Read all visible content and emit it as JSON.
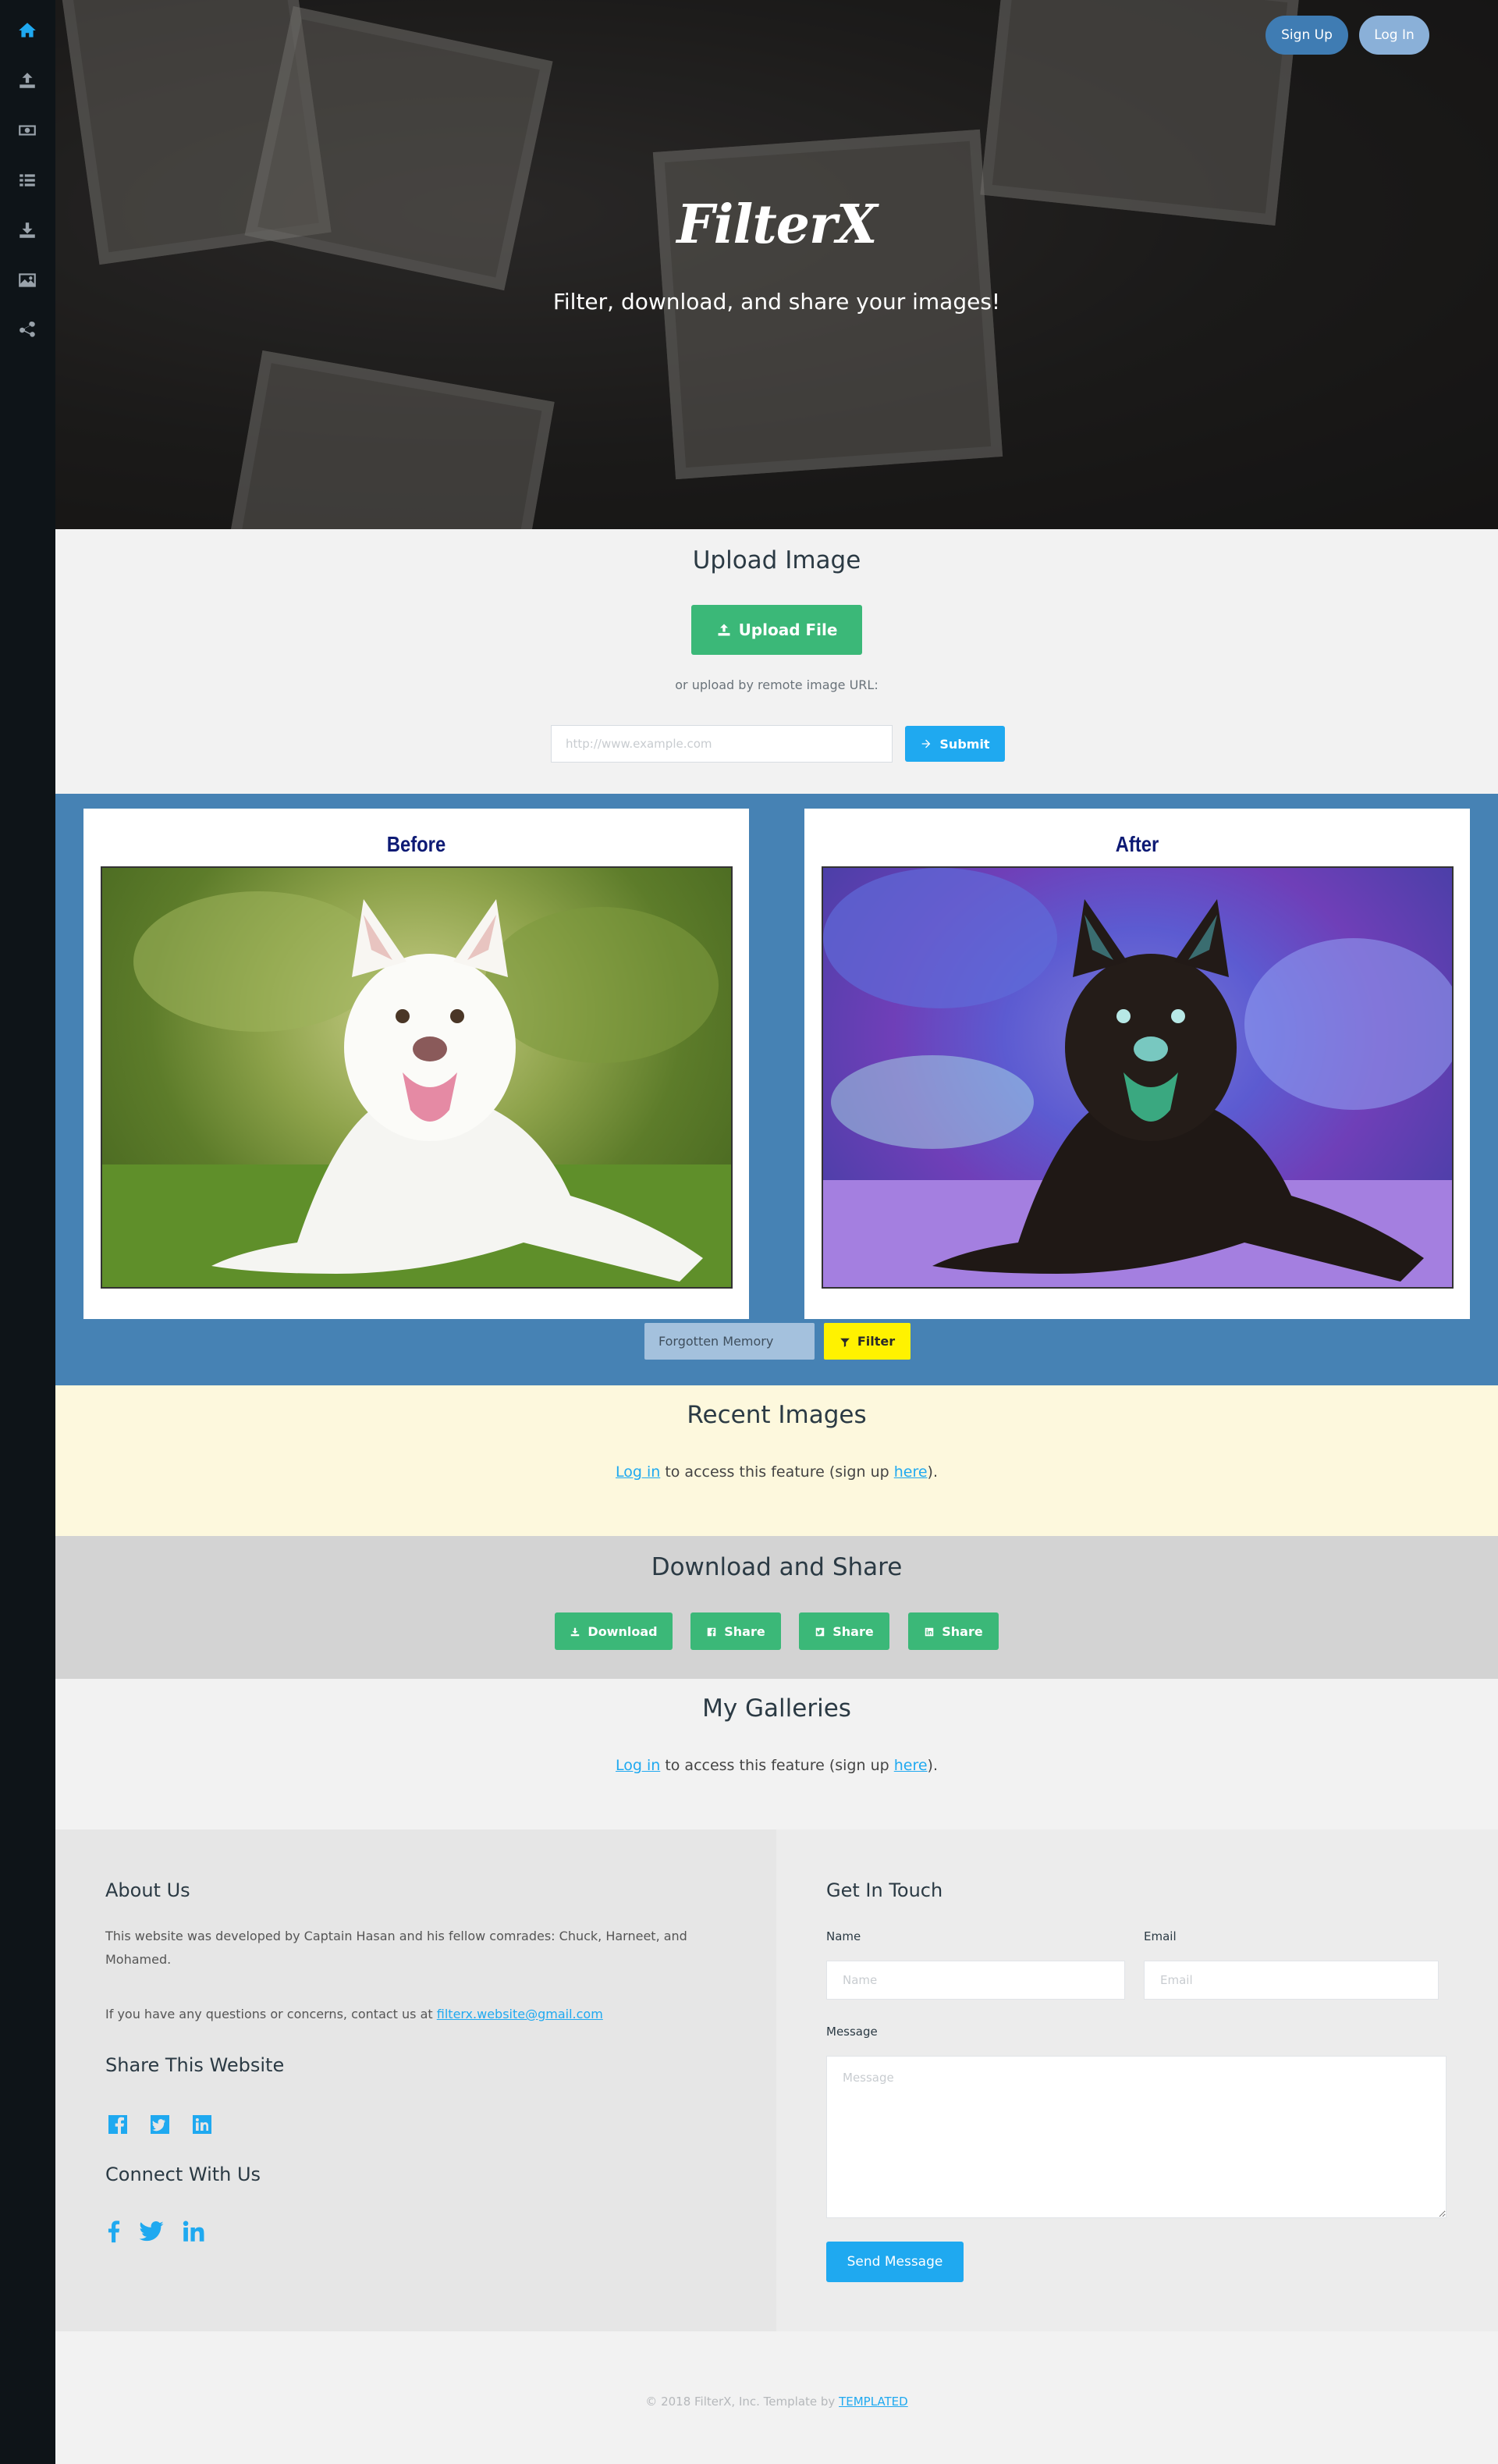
{
  "sidebar": {
    "icons": [
      "home-icon",
      "upload-icon",
      "money-icon",
      "list-icon",
      "download-icon",
      "image-icon",
      "share-icon"
    ]
  },
  "hero": {
    "title": "FilterX",
    "subtitle": "Filter, download, and share your images!",
    "signup_label": "Sign Up",
    "login_label": "Log In"
  },
  "upload": {
    "title": "Upload Image",
    "upload_button": "Upload File",
    "note": "or upload by remote image URL:",
    "url_placeholder": "http://www.example.com",
    "submit_label": "Submit"
  },
  "filter": {
    "before_label": "Before",
    "after_label": "After",
    "selected_filter": "Forgotten Memory",
    "filter_button": "Filter"
  },
  "recent": {
    "title": "Recent Images",
    "login_link": "Log in",
    "text_middle": " to access this feature (sign up ",
    "signup_link": "here",
    "text_end": ")."
  },
  "download": {
    "title": "Download and Share",
    "buttons": [
      "Download",
      "Share",
      "Share",
      "Share"
    ]
  },
  "galleries": {
    "title": "My Galleries",
    "login_link": "Log in",
    "text_middle": " to access this feature (sign up ",
    "signup_link": "here",
    "text_end": ")."
  },
  "footer": {
    "about_heading": "About Us",
    "about_text": "This website was developed by Captain Hasan and his fellow comrades: Chuck, Harneet, and Mohamed.",
    "contact_text": "If you have any questions or concerns, contact us at ",
    "contact_email": "filterx.website@gmail.com",
    "share_heading": "Share This Website",
    "connect_heading": "Connect With Us",
    "touch_heading": "Get In Touch",
    "name_label": "Name",
    "name_placeholder": "Name",
    "email_label": "Email",
    "email_placeholder": "Email",
    "message_label": "Message",
    "message_placeholder": "Message",
    "send_label": "Send Message"
  },
  "copyright": {
    "text": "© 2018 FilterX, Inc. Template by ",
    "link": "TEMPLATED"
  },
  "colors": {
    "accent": "#1fa9f0",
    "green": "#3bb878",
    "filter_bg": "#4682b4",
    "recent_bg": "#fdf8dd",
    "download_bg": "#d3d3d3",
    "filter_button": "#fff200"
  }
}
